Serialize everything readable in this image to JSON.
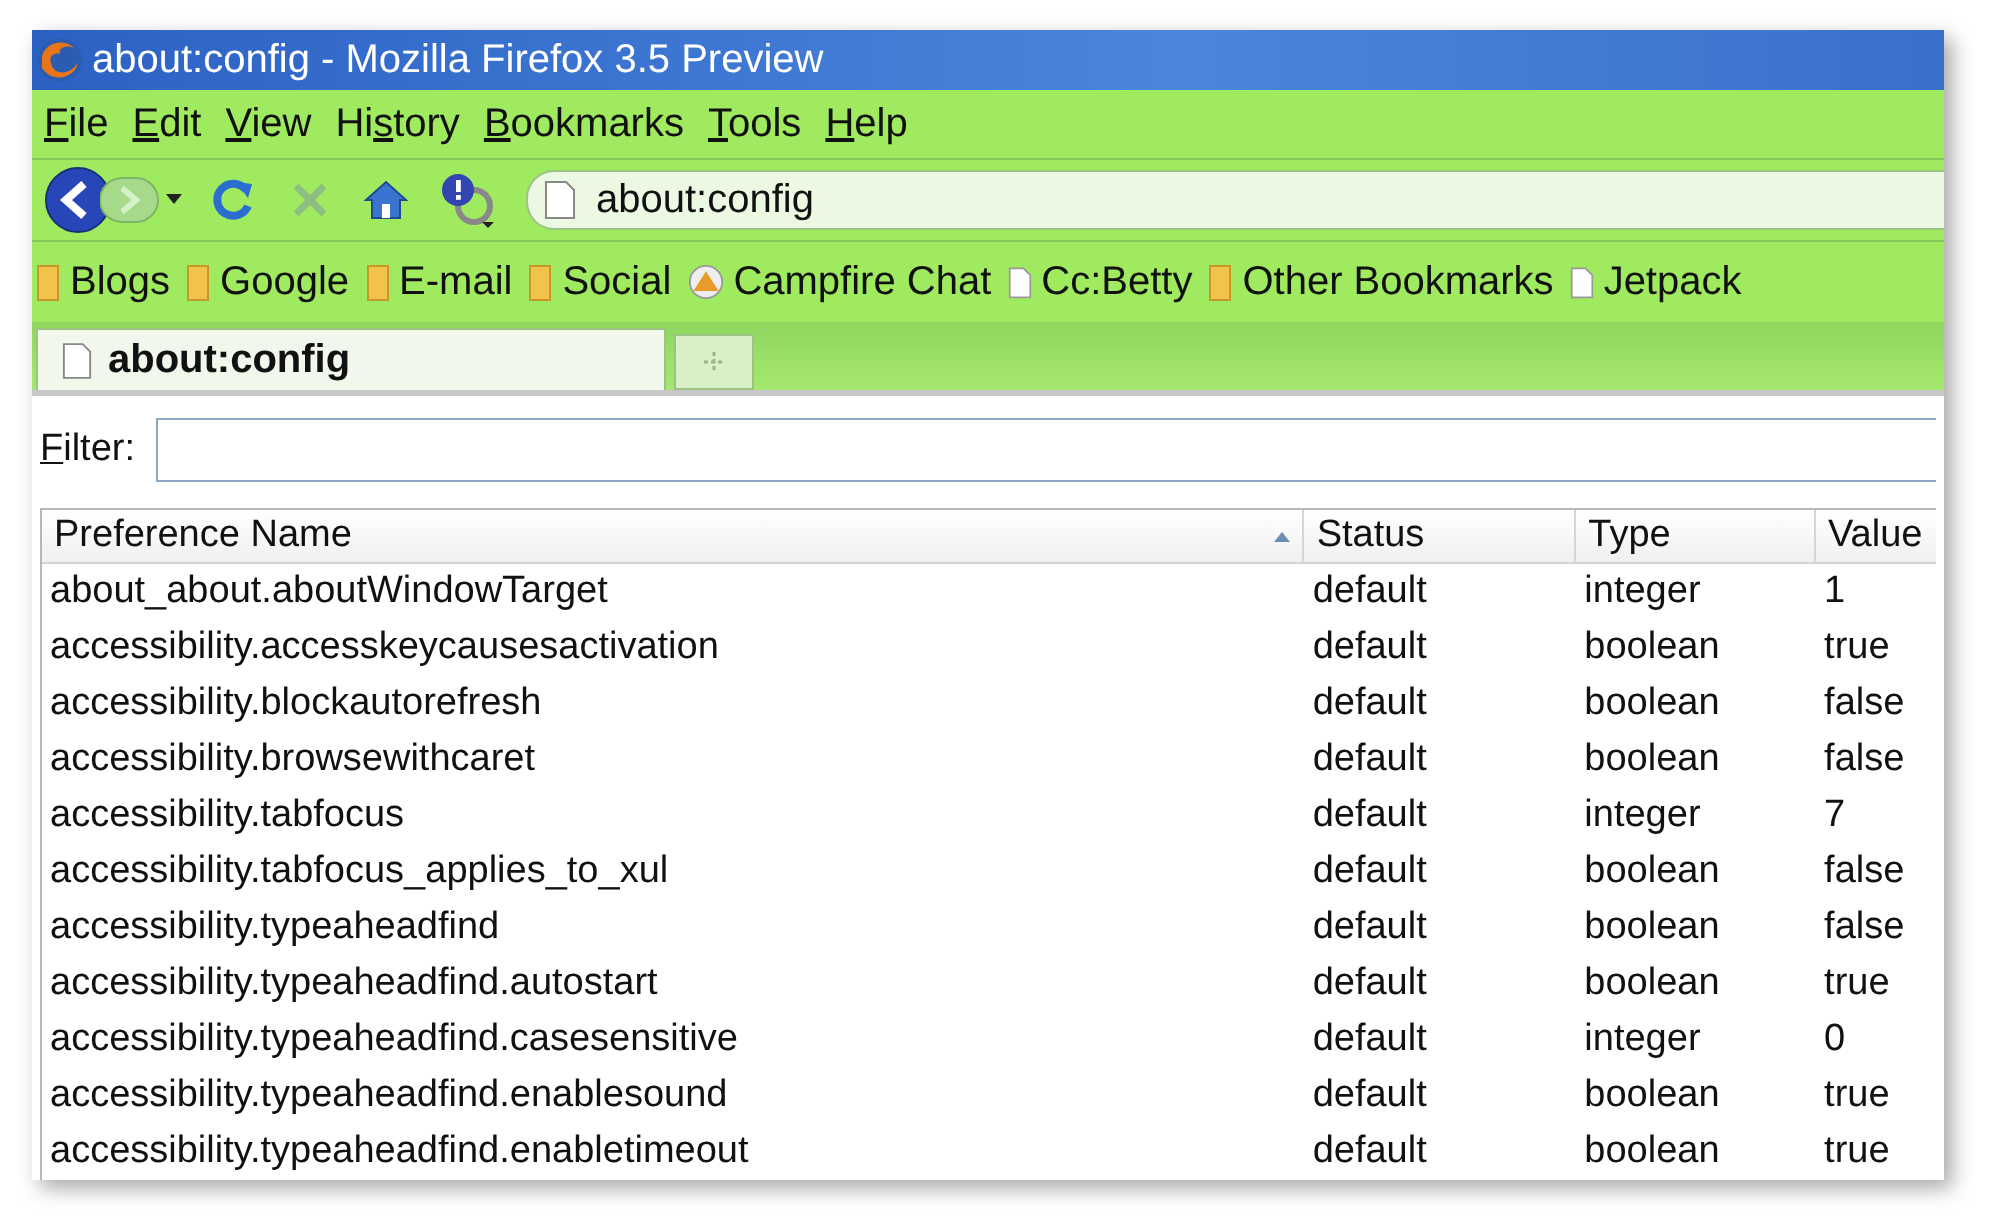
{
  "window": {
    "title": "about:config - Mozilla Firefox 3.5 Preview"
  },
  "menu": [
    {
      "key": "F",
      "after": "ile"
    },
    {
      "key": "E",
      "after": "dit"
    },
    {
      "key": "V",
      "after": "iew"
    },
    {
      "before": "Hi",
      "key": "s",
      "after": "tory"
    },
    {
      "key": "B",
      "after": "ookmarks"
    },
    {
      "key": "T",
      "after": "ools"
    },
    {
      "key": "H",
      "after": "elp"
    }
  ],
  "navigation": {
    "forward_disabled": true,
    "stop_disabled": true,
    "url": "about:config"
  },
  "bookmarks": [
    {
      "label": "Blogs",
      "kind": "folder"
    },
    {
      "label": "Google",
      "kind": "folder"
    },
    {
      "label": "E-mail",
      "kind": "folder"
    },
    {
      "label": "Social",
      "kind": "folder"
    },
    {
      "label": "Campfire Chat",
      "kind": "app"
    },
    {
      "label": "Cc:Betty",
      "kind": "page"
    },
    {
      "label": "Other Bookmarks",
      "kind": "folder"
    },
    {
      "label": "Jetpack",
      "kind": "page"
    }
  ],
  "tabs": [
    {
      "label": "about:config",
      "selected": true
    }
  ],
  "filter": {
    "key": "F",
    "after": "ilter:"
  },
  "table": {
    "columns": [
      {
        "label": "Preference Name",
        "sorted": true
      },
      {
        "label": "Status",
        "sorted": false
      },
      {
        "label": "Type",
        "sorted": false
      },
      {
        "label": "Value",
        "sorted": false
      }
    ],
    "rows": [
      [
        "about_about.aboutWindowTarget",
        "default",
        "integer",
        "1"
      ],
      [
        "accessibility.accesskeycausesactivation",
        "default",
        "boolean",
        "true"
      ],
      [
        "accessibility.blockautorefresh",
        "default",
        "boolean",
        "false"
      ],
      [
        "accessibility.browsewithcaret",
        "default",
        "boolean",
        "false"
      ],
      [
        "accessibility.tabfocus",
        "default",
        "integer",
        "7"
      ],
      [
        "accessibility.tabfocus_applies_to_xul",
        "default",
        "boolean",
        "false"
      ],
      [
        "accessibility.typeaheadfind",
        "default",
        "boolean",
        "false"
      ],
      [
        "accessibility.typeaheadfind.autostart",
        "default",
        "boolean",
        "true"
      ],
      [
        "accessibility.typeaheadfind.casesensitive",
        "default",
        "integer",
        "0"
      ],
      [
        "accessibility.typeaheadfind.enablesound",
        "default",
        "boolean",
        "true"
      ],
      [
        "accessibility.typeaheadfind.enabletimeout",
        "default",
        "boolean",
        "true"
      ]
    ]
  }
}
